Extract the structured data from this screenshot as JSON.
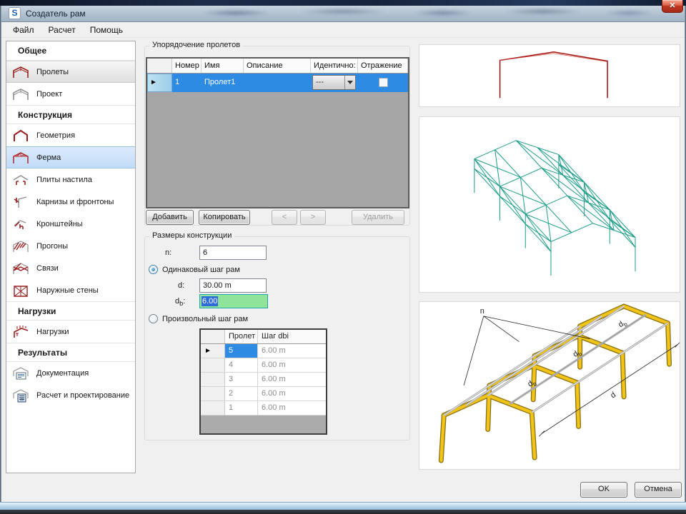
{
  "window": {
    "title": "Создатель рам",
    "logo": "S",
    "close": "✕"
  },
  "menu": {
    "file": "Файл",
    "calc": "Расчет",
    "help": "Помощь"
  },
  "sidebar": {
    "sections": {
      "general": "Общее",
      "construction": "Конструкция",
      "loads": "Нагрузки",
      "results": "Результаты"
    },
    "items": {
      "spans": "Пролеты",
      "project": "Проект",
      "geometry": "Геометрия",
      "truss": "Ферма",
      "deck": "Плиты настила",
      "eaves": "Карнизы и фронтоны",
      "brackets": "Кронштейны",
      "purlins": "Прогоны",
      "bracing": "Связи",
      "walls": "Наружные стены",
      "loads": "Нагрузки",
      "docs": "Документация",
      "design": "Расчет и проектирование"
    }
  },
  "ordering": {
    "title": "Упорядочение пролетов",
    "columns": {
      "number": "Номер",
      "name": "Имя",
      "desc": "Описание",
      "identical": "Идентично:",
      "mirror": "Отражение"
    },
    "row": {
      "marker": "►",
      "number": "1",
      "name": "Пролет1",
      "desc": "",
      "identical": "---"
    },
    "buttons": {
      "add": "Добавить",
      "copy": "Копировать",
      "prev": "<",
      "next": ">",
      "del": "Удалить"
    }
  },
  "dims": {
    "title": "Размеры конструкции",
    "n_label": "n:",
    "n_value": "6",
    "radio_uniform": "Одинаковый шаг рам",
    "d_label": "d:",
    "d_value": "30.00 m",
    "db_base": "d",
    "db_sub": "b",
    "db_colon": ":",
    "db_value": "6.00",
    "radio_custom": "Произвольный шаг рам",
    "table": {
      "marker": "►",
      "col_span": "Пролет",
      "col_step": "Шаг dbi",
      "rows": [
        [
          "5",
          "6.00 m"
        ],
        [
          "4",
          "6.00 m"
        ],
        [
          "3",
          "6.00 m"
        ],
        [
          "2",
          "6.00 m"
        ],
        [
          "1",
          "6.00 m"
        ]
      ]
    }
  },
  "previews": {
    "n": "n",
    "db": "d",
    "db_sub": "b",
    "d": "d"
  },
  "footer": {
    "ok": "OK",
    "cancel": "Отмена"
  },
  "colors": {
    "selection_blue": "#2e8be4",
    "sidebar_selected": "#c1dbf7",
    "green_field": "#8fe49a",
    "frame_red": "#a31515",
    "wire_teal": "#1a9c87",
    "frame_gold": "#f0c419",
    "close_red": "#c23a24"
  }
}
